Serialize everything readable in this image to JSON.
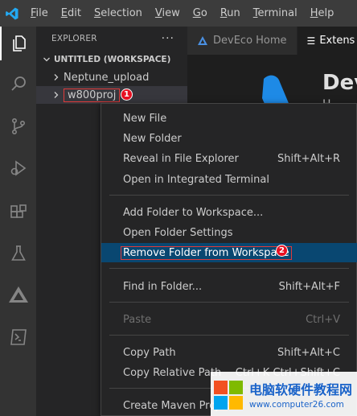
{
  "menubar": {
    "items": [
      {
        "mnemonic": "F",
        "rest": "ile"
      },
      {
        "mnemonic": "E",
        "rest": "dit"
      },
      {
        "mnemonic": "S",
        "rest": "election"
      },
      {
        "mnemonic": "V",
        "rest": "iew"
      },
      {
        "mnemonic": "G",
        "rest": "o"
      },
      {
        "mnemonic": "R",
        "rest": "un"
      },
      {
        "mnemonic": "T",
        "rest": "erminal"
      },
      {
        "mnemonic": "H",
        "rest": "elp"
      }
    ]
  },
  "sidebar": {
    "title": "EXPLORER",
    "more": "···",
    "workspace": "UNTITLED (WORKSPACE)",
    "folders": [
      "Neptune_upload",
      "w800proj"
    ],
    "annotation1": "1"
  },
  "tabs": [
    "DevEco Home",
    "Extens"
  ],
  "editor": {
    "heading": "Dev",
    "sub": "H"
  },
  "context_menu": {
    "items": [
      {
        "label": "New File",
        "shortcut": ""
      },
      {
        "label": "New Folder",
        "shortcut": ""
      },
      {
        "label": "Reveal in File Explorer",
        "shortcut": "Shift+Alt+R"
      },
      {
        "label": "Open in Integrated Terminal",
        "shortcut": ""
      },
      {
        "label": "Add Folder to Workspace...",
        "shortcut": ""
      },
      {
        "label": "Open Folder Settings",
        "shortcut": ""
      },
      {
        "label": "Remove Folder from Workspace",
        "shortcut": ""
      },
      {
        "label": "Find in Folder...",
        "shortcut": "Shift+Alt+F"
      },
      {
        "label": "Paste",
        "shortcut": "Ctrl+V"
      },
      {
        "label": "Copy Path",
        "shortcut": "Shift+Alt+C"
      },
      {
        "label": "Copy Relative Path",
        "shortcut": "Ctrl+K Ctrl+Shift+C"
      },
      {
        "label": "Create Maven Project",
        "shortcut": ""
      }
    ],
    "annotation2": "2"
  },
  "watermark": {
    "cn": "电脑软硬件教程网",
    "url": "www.computer26.com"
  },
  "colors": {
    "accent_blue": "#0078d4",
    "highlight": "#094771",
    "annotation_red": "#e81123"
  }
}
